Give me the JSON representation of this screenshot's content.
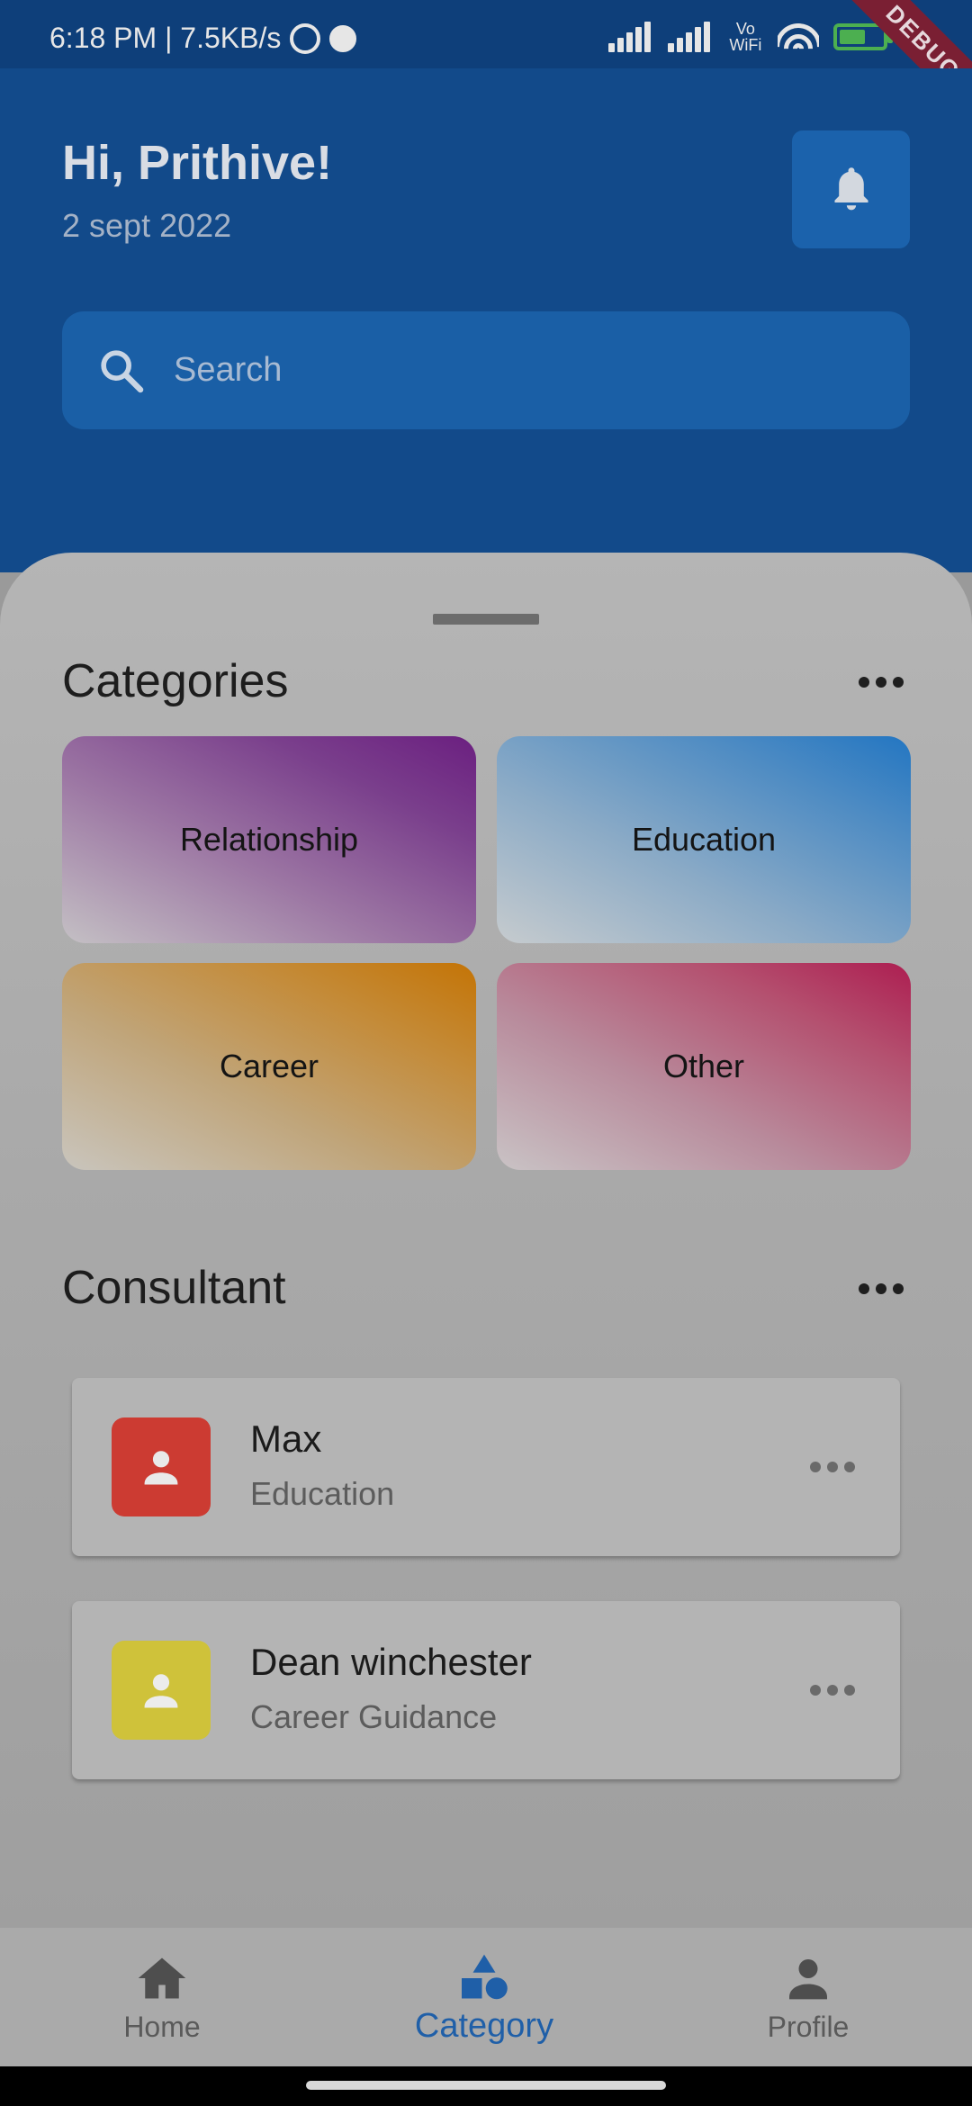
{
  "status": {
    "time_speed": "6:18 PM | 7.5KB/s",
    "vowifi": "Vo WiFi",
    "battery": "56",
    "debug_banner": "DEBUG"
  },
  "header": {
    "greeting": "Hi, Prithive!",
    "date": "2 sept 2022",
    "notification_icon": "bell-icon"
  },
  "search": {
    "placeholder": "Search",
    "icon": "search-icon"
  },
  "categories": {
    "title": "Categories",
    "items": [
      {
        "label": "Relationship",
        "accent": "#6b1f80"
      },
      {
        "label": "Education",
        "accent": "#2376c2"
      },
      {
        "label": "Career",
        "accent": "#c47406"
      },
      {
        "label": "Other",
        "accent": "#ad1e51"
      }
    ]
  },
  "consultant": {
    "title": "Consultant",
    "items": [
      {
        "name": "Max",
        "specialty": "Education",
        "avatar_color": "#cc3b32"
      },
      {
        "name": "Dean winchester",
        "specialty": "Career Guidance",
        "avatar_color": "#cfc23a"
      }
    ]
  },
  "bottom_nav": {
    "active": "Category",
    "items": [
      {
        "label": "Home",
        "icon": "home-icon"
      },
      {
        "label": "Category",
        "icon": "category-icon"
      },
      {
        "label": "Profile",
        "icon": "person-icon"
      }
    ]
  },
  "colors": {
    "header_bg": "#124a8a",
    "accent": "#1f5fa8"
  }
}
